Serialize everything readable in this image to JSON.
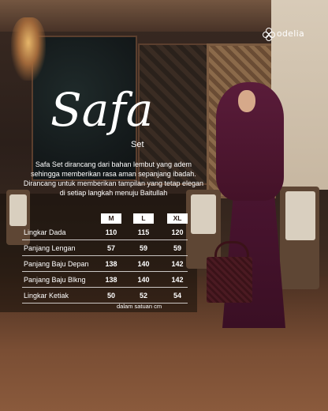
{
  "brand": {
    "logo_text": "odelia",
    "logo_icon": "flower-icon"
  },
  "product": {
    "title": "Safa",
    "subtitle": "Set"
  },
  "description": "Safa Set dirancang dari bahan lembut yang adem sehingga memberikan rasa aman sepanjang ibadah. Dirancang untuk memberikan tampilan yang tetap elegan di setiap langkah menuju Baitullah",
  "size_table": {
    "columns": [
      "M",
      "L",
      "XL"
    ],
    "rows": [
      {
        "label": "Lingkar Dada",
        "values": [
          "110",
          "115",
          "120"
        ]
      },
      {
        "label": "Panjang Lengan",
        "values": [
          "57",
          "59",
          "59"
        ]
      },
      {
        "label": "Panjang Baju Depan",
        "values": [
          "138",
          "140",
          "142"
        ]
      },
      {
        "label": "Panjang Baju Blkng",
        "values": [
          "138",
          "140",
          "142"
        ]
      },
      {
        "label": "Lingkar Ketiak",
        "values": [
          "50",
          "52",
          "54"
        ]
      }
    ],
    "note": "dalam satuan cm"
  },
  "colors": {
    "text": "#ffffff",
    "garment": "#4a1430",
    "header_bg": "#ffffff"
  }
}
